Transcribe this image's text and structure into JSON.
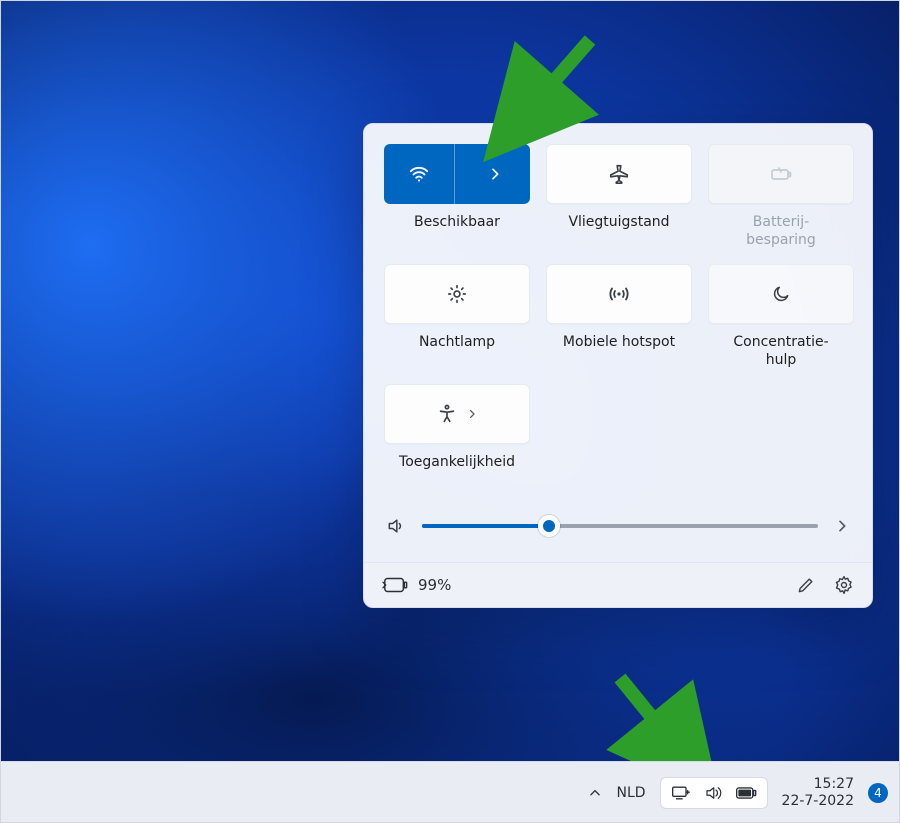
{
  "colors": {
    "accent": "#0067c0",
    "arrow": "#2e9e2b"
  },
  "tiles": {
    "wifi": {
      "label": "Beschikbaar",
      "active": true,
      "has_chevron": true,
      "icon": "wifi"
    },
    "airplane": {
      "label": "Vliegtuigstand",
      "icon": "airplane"
    },
    "battery": {
      "label": "Batterij-\nbesparing",
      "icon": "battery-saver",
      "disabled": true
    },
    "nightlight": {
      "label": "Nachtlamp",
      "icon": "brightness"
    },
    "hotspot": {
      "label": "Mobiele hotspot",
      "icon": "hotspot"
    },
    "focus": {
      "label": "Concentratie-\nhulp",
      "icon": "moon"
    },
    "access": {
      "label": "Toegankelijkheid",
      "icon": "accessibility",
      "has_chevron": true
    }
  },
  "volume": {
    "percent": 32
  },
  "footer": {
    "battery_text": "99%"
  },
  "taskbar": {
    "lang": "NLD",
    "time": "15:27",
    "date": "22-7-2022",
    "notif_count": "4"
  }
}
